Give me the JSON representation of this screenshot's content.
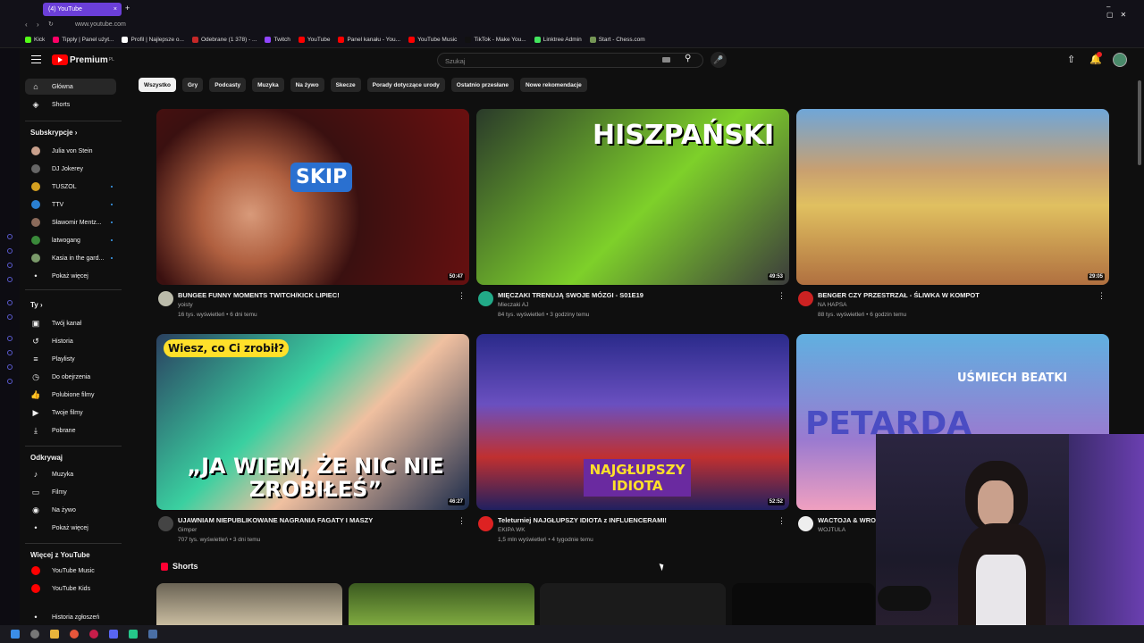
{
  "browser": {
    "tab_title": "(4) YouTube",
    "url": "www.youtube.com",
    "bookmarks": [
      "Kick",
      "Tipply | Panel użyt...",
      "Profil | Najlepsze o...",
      "Odebrane (1 378) - ...",
      "Twitch",
      "YouTube",
      "Panel kanału - You...",
      "YouTube Music",
      "TikTok - Make You...",
      "Linktree Admin",
      "Start - Chess.com"
    ]
  },
  "header": {
    "logo_text": "Premium",
    "logo_sup": "PL",
    "search_placeholder": "Szukaj",
    "notifications_count": "9+"
  },
  "sidebar": {
    "main": [
      {
        "label": "Główna",
        "icon": "home-icon"
      },
      {
        "label": "Shorts",
        "icon": "shorts-icon"
      }
    ],
    "subs_heading": "Subskrypcje",
    "subs": [
      {
        "label": "Julia von Stein"
      },
      {
        "label": "DJ Jokerey"
      },
      {
        "label": "TUSZOL"
      },
      {
        "label": "TTV"
      },
      {
        "label": "Sławomir Mentz..."
      },
      {
        "label": "latwogang"
      },
      {
        "label": "Kasia in the gard..."
      }
    ],
    "show_more": "Pokaż więcej",
    "you_heading": "Ty",
    "you": [
      {
        "label": "Twój kanał",
        "icon": "channel-icon"
      },
      {
        "label": "Historia",
        "icon": "history-icon"
      },
      {
        "label": "Playlisty",
        "icon": "playlist-icon"
      },
      {
        "label": "Do obejrzenia",
        "icon": "watch-later-icon"
      },
      {
        "label": "Polubione filmy",
        "icon": "like-icon"
      },
      {
        "label": "Twoje filmy",
        "icon": "video-icon"
      },
      {
        "label": "Pobrane",
        "icon": "download-icon"
      }
    ],
    "explore_heading": "Odkrywaj",
    "explore": [
      {
        "label": "Muzyka",
        "icon": "music-icon"
      },
      {
        "label": "Filmy",
        "icon": "film-icon"
      },
      {
        "label": "Na żywo",
        "icon": "live-icon"
      }
    ],
    "explore_more": "Pokaż więcej",
    "more_heading": "Więcej z YouTube",
    "more": [
      {
        "label": "YouTube Music"
      },
      {
        "label": "YouTube Kids"
      }
    ],
    "report": "Historia zgłoszeń"
  },
  "chips": [
    "Wszystko",
    "Gry",
    "Podcasty",
    "Muzyka",
    "Na żywo",
    "Skecze",
    "Porady dotyczące urody",
    "Ostatnio przesłane",
    "Nowe rekomendacje"
  ],
  "videos": [
    {
      "title": "BUNGEE FUNNY MOMENTS TWITCH/KICK LIPIEC!",
      "channel": "yoisty",
      "meta": "16 tys. wyświetleń • 6 dni temu",
      "duration": "50:47",
      "overlay": "SKIP"
    },
    {
      "title": "MIĘCZAKI TRENUJĄ SWOJE MÓZGI - S01E19",
      "channel": "Mieczaki AJ",
      "meta": "84 tys. wyświetleń • 3 godziny temu",
      "duration": "49:53",
      "overlay": "HISZPAŃSKI"
    },
    {
      "title": "BENGER CZY PRZESTRZAŁ - ŚLIWKA W KOMPOT",
      "channel": "NA HAPSA",
      "meta": "88 tys. wyświetleń • 6 godzin temu",
      "duration": "29:05",
      "overlay": ""
    },
    {
      "title": "UJAWNIAM NIEPUBLIKOWANE NAGRANIA FAGATY I MASZY",
      "channel": "Gimper",
      "meta": "707 tys. wyświetleń • 3 dni temu",
      "duration": "46:27",
      "overlay": "„JA WIEM, ŻE NIC NIE ZROBIŁEŚ”",
      "overlay2": "Wiesz, co Ci zrobił?"
    },
    {
      "title": "Teleturniej NAJGŁUPSZY IDIOTA z INFLUENCERAMI!",
      "channel": "EKIPA WK",
      "meta": "1,5 mln wyświetleń • 4 tygodnie temu",
      "duration": "52:52",
      "overlay": "NAJGŁUPSZY IDIOTA"
    },
    {
      "title": "WACTOJA & WRO...",
      "channel": "WOJTULA",
      "meta": "",
      "duration": "",
      "overlay": "UŚMIECH BEATKI",
      "overlay2": "PETARDA"
    }
  ],
  "shorts_heading": "Shorts",
  "colors": {
    "accent": "#ff0000",
    "bg": "#0f0f0f",
    "chip": "#272727",
    "tab": "#6b3fd8"
  }
}
